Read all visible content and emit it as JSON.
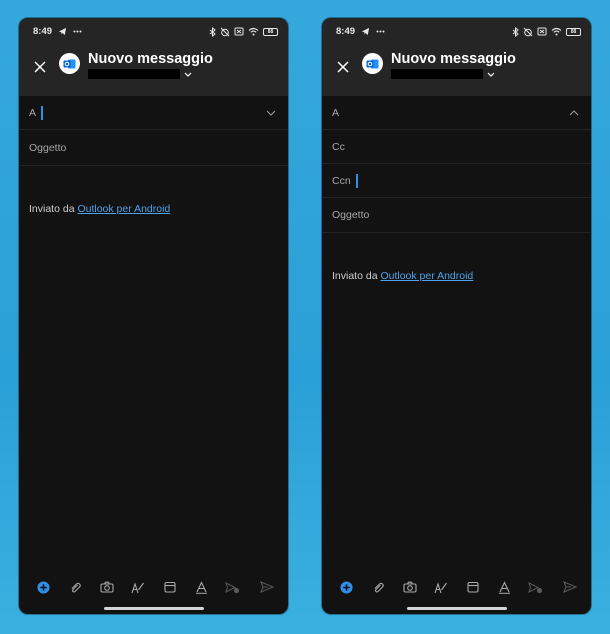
{
  "screens": [
    {
      "status": {
        "time": "8:49",
        "battery": "88"
      },
      "header": {
        "title": "Nuovo messaggio"
      },
      "fields": {
        "to_label": "A",
        "cc_label": "",
        "bcc_label": "",
        "subject_placeholder": "Oggetto"
      },
      "signature": {
        "prefix": "Inviato da ",
        "link": "Outlook per Android"
      },
      "toggle_state": "collapsed"
    },
    {
      "status": {
        "time": "8:49",
        "battery": "88"
      },
      "header": {
        "title": "Nuovo messaggio"
      },
      "fields": {
        "to_label": "A",
        "cc_label": "Cc",
        "bcc_label": "Ccn",
        "subject_placeholder": "Oggetto"
      },
      "signature": {
        "prefix": "Inviato da ",
        "link": "Outlook per Android"
      },
      "toggle_state": "expanded"
    }
  ],
  "icons": {
    "close": "close-icon",
    "outlook": "outlook-logo-icon",
    "chevron_down": "chevron-down-icon",
    "chevron_up": "chevron-up-icon",
    "toolbar": [
      "add-icon",
      "attach-icon",
      "camera-icon",
      "pen-icon",
      "calendar-icon",
      "format-text-icon",
      "dictation-icon",
      "send-icon"
    ]
  },
  "colors": {
    "accent": "#2f8ee8",
    "link": "#4ea2ea",
    "background": "#121212",
    "header": "#252525",
    "outer_background": "#2aa0d8"
  }
}
